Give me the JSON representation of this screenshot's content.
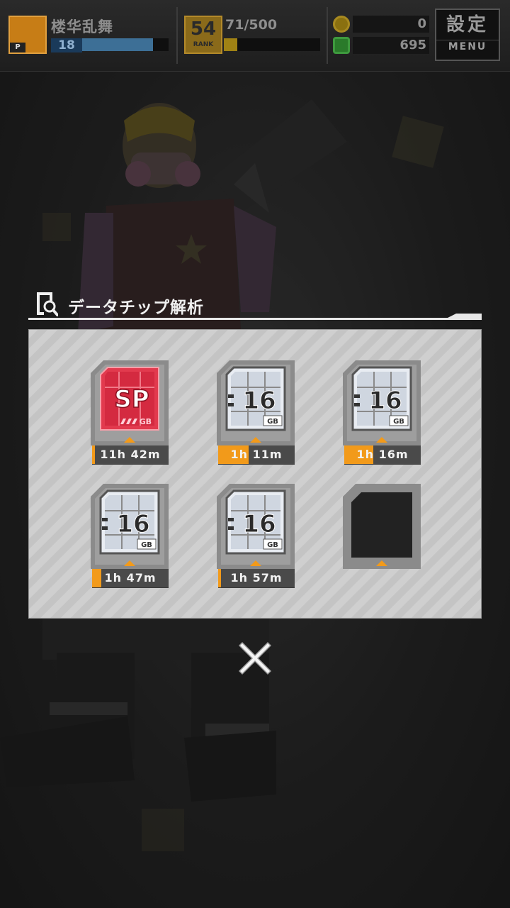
{
  "hud": {
    "player": {
      "name": "楼华乱舞",
      "badge_label": "P",
      "level": "18",
      "exp_fraction": 0.82
    },
    "rank": {
      "value": "54",
      "label": "RANK",
      "stamina_text": "71/500",
      "stamina_fraction": 0.14
    },
    "currency": {
      "coins": "0",
      "gems": "695"
    },
    "menu": {
      "kanji": "設定",
      "label": "MENU"
    }
  },
  "modal": {
    "title": "データチップ解析",
    "slots": [
      {
        "chip": "SP",
        "unit": "GB",
        "kind": "sp",
        "timer": "11h 42m",
        "progress": 0.03
      },
      {
        "chip": "16",
        "unit": "GB",
        "kind": "normal",
        "timer": "1h 11m",
        "progress": 0.4
      },
      {
        "chip": "16",
        "unit": "GB",
        "kind": "normal",
        "timer": "1h 16m",
        "progress": 0.38
      },
      {
        "chip": "16",
        "unit": "GB",
        "kind": "normal",
        "timer": "1h 47m",
        "progress": 0.12
      },
      {
        "chip": "16",
        "unit": "GB",
        "kind": "normal",
        "timer": "1h 57m",
        "progress": 0.04
      },
      {
        "chip": "",
        "unit": "",
        "kind": "empty",
        "timer": "",
        "progress": 0
      }
    ]
  },
  "colors": {
    "accent_orange": "#f29a1a",
    "sp_chip": "#e23a4e",
    "panel": "#cfcfcf"
  }
}
